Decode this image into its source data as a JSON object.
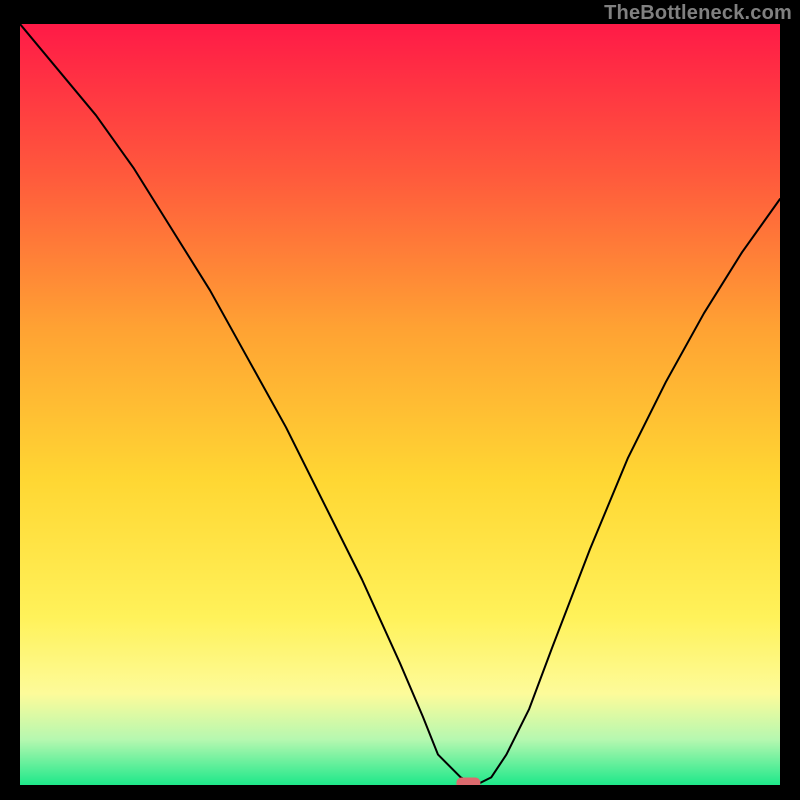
{
  "watermark": "TheBottleneck.com",
  "chart_data": {
    "type": "line",
    "title": "",
    "xlabel": "",
    "ylabel": "",
    "xlim": [
      0,
      100
    ],
    "ylim": [
      0,
      100
    ],
    "grid": false,
    "legend": false,
    "background": {
      "kind": "vertical-gradient",
      "stops": [
        {
          "offset": 0.0,
          "color": "#ff1a47"
        },
        {
          "offset": 0.2,
          "color": "#ff5a3c"
        },
        {
          "offset": 0.4,
          "color": "#ffa233"
        },
        {
          "offset": 0.6,
          "color": "#ffd733"
        },
        {
          "offset": 0.78,
          "color": "#fff25a"
        },
        {
          "offset": 0.88,
          "color": "#fdfb9a"
        },
        {
          "offset": 0.94,
          "color": "#b6f8b0"
        },
        {
          "offset": 1.0,
          "color": "#1ee88a"
        }
      ]
    },
    "series": [
      {
        "name": "bottleneck-curve",
        "x": [
          0,
          5,
          10,
          15,
          20,
          25,
          30,
          35,
          40,
          45,
          50,
          53,
          55,
          58,
          60,
          62,
          64,
          67,
          70,
          75,
          80,
          85,
          90,
          95,
          100
        ],
        "values": [
          100,
          94,
          88,
          81,
          73,
          65,
          56,
          47,
          37,
          27,
          16,
          9,
          4,
          1,
          0,
          1,
          4,
          10,
          18,
          31,
          43,
          53,
          62,
          70,
          77
        ]
      }
    ],
    "marker": {
      "x": 59,
      "y": 0,
      "color": "#dc6a6e",
      "shape": "pill"
    }
  }
}
